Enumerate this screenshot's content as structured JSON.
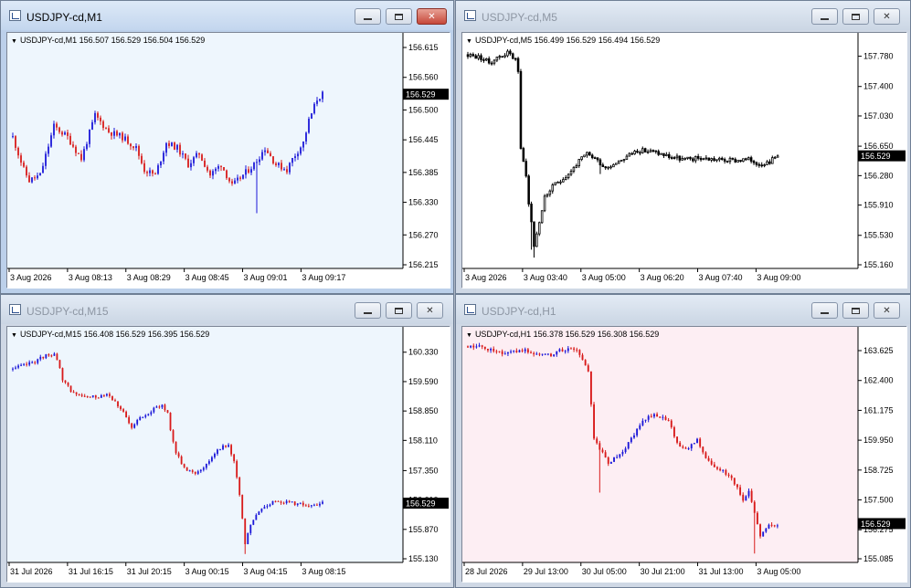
{
  "windows": [
    {
      "id": "m1",
      "title": "USDJPY-cd,M1",
      "active": true,
      "chart_label": "USDJPY-cd,M1  156.507 156.529 156.504 156.529",
      "background": "#eef6fd",
      "bull_color": "#1b17d8",
      "bear_color": "#d81a1a",
      "line_mode": false,
      "price_badge": "156.529",
      "price_ticks": [
        "156.615",
        "156.560",
        "156.500",
        "156.445",
        "156.385",
        "156.330",
        "156.270",
        "156.215"
      ],
      "time_ticks": [
        "3 Aug 2026",
        "3 Aug 08:13",
        "3 Aug 08:29",
        "3 Aug 08:45",
        "3 Aug 09:01",
        "3 Aug 09:17"
      ]
    },
    {
      "id": "m5",
      "title": "USDJPY-cd,M5",
      "active": false,
      "chart_label": "USDJPY-cd,M5  156.499 156.529 156.494 156.529",
      "background": "#ffffff",
      "bull_color": "#000000",
      "bear_color": "#000000",
      "line_mode": true,
      "price_badge": "156.529",
      "price_ticks": [
        "157.780",
        "157.400",
        "157.030",
        "156.650",
        "156.280",
        "155.910",
        "155.530",
        "155.160"
      ],
      "time_ticks": [
        "3 Aug 2026",
        "3 Aug 03:40",
        "3 Aug 05:00",
        "3 Aug 06:20",
        "3 Aug 07:40",
        "3 Aug 09:00"
      ]
    },
    {
      "id": "m15",
      "title": "USDJPY-cd,M15",
      "active": false,
      "chart_label": "USDJPY-cd,M15  156.408 156.529 156.395 156.529",
      "background": "#eef6fd",
      "bull_color": "#1b17d8",
      "bear_color": "#d81a1a",
      "line_mode": false,
      "price_badge": "156.529",
      "price_ticks": [
        "160.330",
        "159.590",
        "158.850",
        "158.110",
        "157.350",
        "156.610",
        "155.870",
        "155.130"
      ],
      "time_ticks": [
        "31 Jul 2026",
        "31 Jul 16:15",
        "31 Jul 20:15",
        "3 Aug 00:15",
        "3 Aug 04:15",
        "3 Aug 08:15"
      ]
    },
    {
      "id": "h1",
      "title": "USDJPY-cd,H1",
      "active": false,
      "chart_label": "USDJPY-cd,H1  156.378 156.529 156.308 156.529",
      "background": "#fdeef3",
      "bull_color": "#1b17d8",
      "bear_color": "#d81a1a",
      "line_mode": false,
      "price_badge": "156.529",
      "price_ticks": [
        "163.625",
        "162.400",
        "161.175",
        "159.950",
        "158.725",
        "157.500",
        "156.275",
        "155.085"
      ],
      "time_ticks": [
        "28 Jul 2026",
        "29 Jul 13:00",
        "30 Jul 05:00",
        "30 Jul 21:00",
        "31 Jul 13:00",
        "3 Aug 05:00"
      ]
    }
  ],
  "icons": {
    "minimize": "minimize-icon",
    "maximize": "maximize-icon",
    "close": "close-icon",
    "close_glyph": "✕",
    "dropdown_glyph": "▼"
  },
  "chart_data": [
    {
      "type": "candlestick",
      "title": "USDJPY-cd,M1",
      "ohlc_header": {
        "open": 156.507,
        "high": 156.529,
        "low": 156.504,
        "close": 156.529
      },
      "ylim": [
        156.215,
        156.615
      ],
      "y_ticks": [
        156.615,
        156.56,
        156.5,
        156.445,
        156.385,
        156.33,
        156.27,
        156.215
      ],
      "last_price": 156.529,
      "anchors": [
        [
          0,
          156.45
        ],
        [
          4,
          156.39
        ],
        [
          6,
          156.37
        ],
        [
          10,
          156.38
        ],
        [
          15,
          156.47
        ],
        [
          20,
          156.45
        ],
        [
          25,
          156.41
        ],
        [
          30,
          156.49
        ],
        [
          35,
          156.46
        ],
        [
          40,
          156.45
        ],
        [
          45,
          156.43
        ],
        [
          48,
          156.39
        ],
        [
          52,
          156.38
        ],
        [
          56,
          156.44
        ],
        [
          60,
          156.43
        ],
        [
          64,
          156.4
        ],
        [
          68,
          156.42
        ],
        [
          72,
          156.38
        ],
        [
          76,
          156.4
        ],
        [
          80,
          156.36
        ],
        [
          84,
          156.38
        ],
        [
          88,
          156.4
        ],
        [
          92,
          156.43
        ],
        [
          96,
          156.4
        ],
        [
          100,
          156.39
        ],
        [
          102,
          156.41
        ],
        [
          106,
          156.44
        ],
        [
          108,
          156.48
        ],
        [
          111,
          156.52
        ],
        [
          113,
          156.529
        ]
      ],
      "n": 114,
      "volatility": 0.012,
      "seed": 11,
      "spikes": [
        {
          "i": 89,
          "low": 156.31
        }
      ]
    },
    {
      "type": "candlestick",
      "title": "USDJPY-cd,M5",
      "ohlc_header": {
        "open": 156.499,
        "high": 156.529,
        "low": 156.494,
        "close": 156.529
      },
      "ylim": [
        155.16,
        157.89
      ],
      "y_ticks": [
        157.78,
        157.4,
        157.03,
        156.65,
        156.28,
        155.91,
        155.53,
        155.16
      ],
      "last_price": 156.529,
      "anchors": [
        [
          0,
          157.8
        ],
        [
          5,
          157.76
        ],
        [
          8,
          157.7
        ],
        [
          12,
          157.78
        ],
        [
          15,
          157.82
        ],
        [
          18,
          157.75
        ],
        [
          19,
          157.6
        ],
        [
          20,
          156.6
        ],
        [
          22,
          156.3
        ],
        [
          23,
          155.92
        ],
        [
          24,
          155.7
        ],
        [
          25,
          155.4
        ],
        [
          27,
          155.7
        ],
        [
          29,
          156.0
        ],
        [
          31,
          156.1
        ],
        [
          34,
          156.2
        ],
        [
          38,
          156.3
        ],
        [
          42,
          156.46
        ],
        [
          45,
          156.55
        ],
        [
          48,
          156.5
        ],
        [
          52,
          156.38
        ],
        [
          56,
          156.45
        ],
        [
          60,
          156.52
        ],
        [
          64,
          156.6
        ],
        [
          70,
          156.58
        ],
        [
          76,
          156.52
        ],
        [
          82,
          156.48
        ],
        [
          88,
          156.5
        ],
        [
          94,
          156.48
        ],
        [
          100,
          156.47
        ],
        [
          106,
          156.48
        ],
        [
          110,
          156.43
        ],
        [
          114,
          156.46
        ],
        [
          117,
          156.529
        ]
      ],
      "n": 118,
      "volatility": 0.06,
      "seed": 23,
      "spikes": [
        {
          "i": 25,
          "low": 155.25
        },
        {
          "i": 24,
          "low": 155.35
        },
        {
          "i": 50,
          "low": 156.3
        }
      ]
    },
    {
      "type": "candlestick",
      "title": "USDJPY-cd,M15",
      "ohlc_header": {
        "open": 156.408,
        "high": 156.529,
        "low": 156.395,
        "close": 156.529
      },
      "ylim": [
        155.13,
        160.6
      ],
      "y_ticks": [
        160.33,
        159.59,
        158.85,
        158.11,
        157.35,
        156.61,
        155.87,
        155.13
      ],
      "last_price": 156.529,
      "anchors": [
        [
          0,
          159.9
        ],
        [
          4,
          160.0
        ],
        [
          8,
          160.1
        ],
        [
          12,
          160.25
        ],
        [
          15,
          160.3
        ],
        [
          17,
          159.9
        ],
        [
          18,
          159.6
        ],
        [
          22,
          159.3
        ],
        [
          26,
          159.2
        ],
        [
          30,
          159.2
        ],
        [
          34,
          159.3
        ],
        [
          37,
          159.1
        ],
        [
          40,
          158.8
        ],
        [
          43,
          158.4
        ],
        [
          46,
          158.7
        ],
        [
          50,
          158.85
        ],
        [
          54,
          159.0
        ],
        [
          56,
          158.8
        ],
        [
          57,
          158.4
        ],
        [
          59,
          157.8
        ],
        [
          62,
          157.4
        ],
        [
          66,
          157.3
        ],
        [
          70,
          157.5
        ],
        [
          74,
          157.9
        ],
        [
          78,
          158.0
        ],
        [
          80,
          157.6
        ],
        [
          82,
          156.7
        ],
        [
          84,
          155.5
        ],
        [
          86,
          156.0
        ],
        [
          90,
          156.4
        ],
        [
          95,
          156.6
        ],
        [
          100,
          156.55
        ],
        [
          105,
          156.5
        ],
        [
          109,
          156.45
        ],
        [
          112,
          156.529
        ]
      ],
      "n": 113,
      "volatility": 0.09,
      "seed": 37,
      "spikes": [
        {
          "i": 84,
          "low": 155.25
        }
      ]
    },
    {
      "type": "candlestick",
      "title": "USDJPY-cd,H1",
      "ohlc_header": {
        "open": 156.378,
        "high": 156.529,
        "low": 156.308,
        "close": 156.529
      },
      "ylim": [
        155.085,
        164.0
      ],
      "y_ticks": [
        163.625,
        162.4,
        161.175,
        159.95,
        158.725,
        157.5,
        156.275,
        155.085
      ],
      "last_price": 156.529,
      "anchors": [
        [
          0,
          163.8
        ],
        [
          6,
          163.75
        ],
        [
          10,
          163.6
        ],
        [
          14,
          163.5
        ],
        [
          20,
          163.6
        ],
        [
          26,
          163.4
        ],
        [
          30,
          163.5
        ],
        [
          34,
          163.7
        ],
        [
          38,
          163.6
        ],
        [
          40,
          163.3
        ],
        [
          42,
          162.8
        ],
        [
          44,
          160.0
        ],
        [
          46,
          159.6
        ],
        [
          49,
          159.0
        ],
        [
          52,
          159.3
        ],
        [
          56,
          159.8
        ],
        [
          60,
          160.6
        ],
        [
          64,
          161.0
        ],
        [
          67,
          160.9
        ],
        [
          70,
          160.7
        ],
        [
          73,
          159.8
        ],
        [
          76,
          159.6
        ],
        [
          80,
          160.0
        ],
        [
          83,
          159.3
        ],
        [
          86,
          158.8
        ],
        [
          90,
          158.6
        ],
        [
          93,
          158.2
        ],
        [
          96,
          157.4
        ],
        [
          98,
          157.8
        ],
        [
          100,
          157.0
        ],
        [
          102,
          156.0
        ],
        [
          105,
          156.4
        ],
        [
          108,
          156.529
        ]
      ],
      "n": 109,
      "volatility": 0.18,
      "seed": 51,
      "spikes": [
        {
          "i": 46,
          "low": 157.8
        },
        {
          "i": 100,
          "low": 155.3
        }
      ]
    }
  ]
}
